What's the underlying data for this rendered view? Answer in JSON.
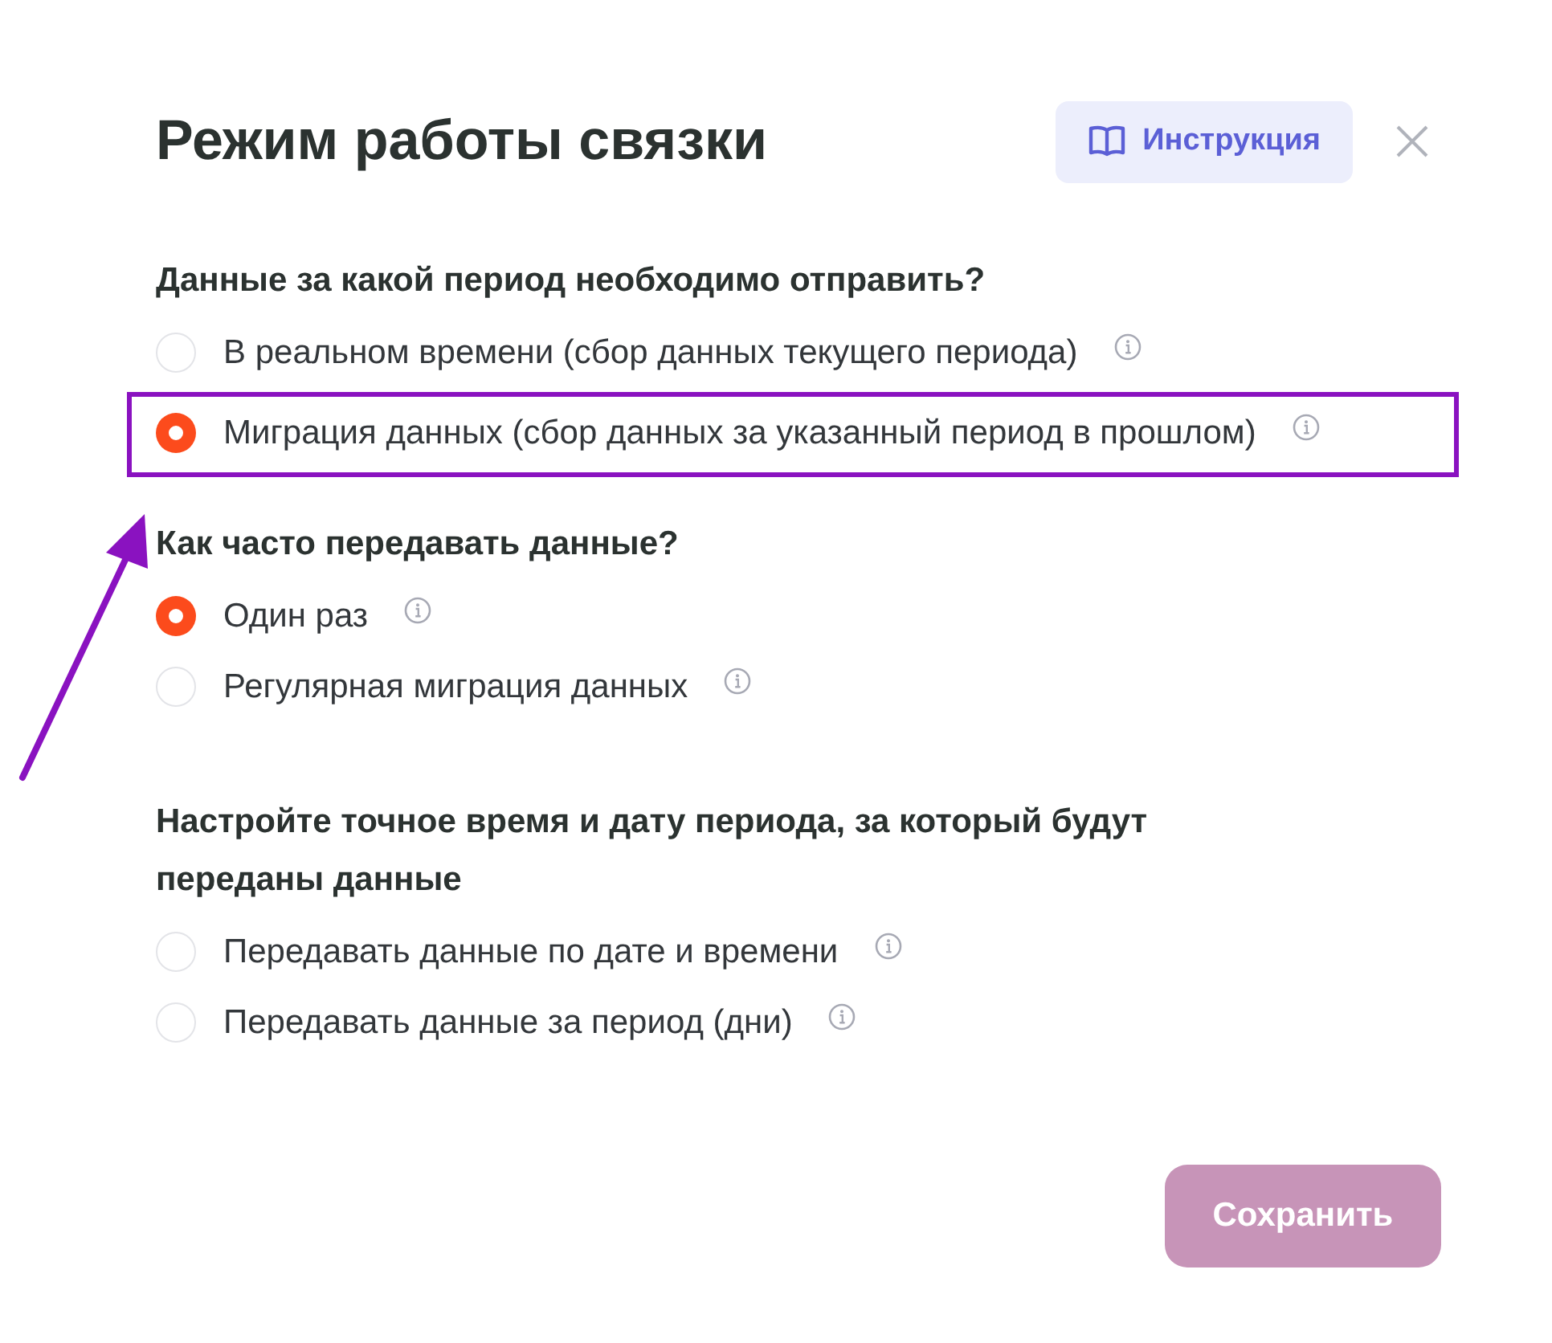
{
  "title": "Режим работы связки",
  "guide_button": {
    "label": "Инструкция"
  },
  "sections": [
    {
      "heading": "Данные за какой период необходимо отправить?",
      "options": [
        {
          "label": "В реальном времени (сбор данных текущего периода)",
          "selected": false,
          "highlighted": false
        },
        {
          "label": "Миграция данных (сбор данных за указанный период в прошлом)",
          "selected": true,
          "highlighted": true
        }
      ]
    },
    {
      "heading": "Как часто передавать данные?",
      "options": [
        {
          "label": "Один раз",
          "selected": true,
          "highlighted": false
        },
        {
          "label": "Регулярная миграция данных",
          "selected": false,
          "highlighted": false
        }
      ]
    },
    {
      "heading": "Настройте точное время и дату периода, за который будут переданы данные",
      "options": [
        {
          "label": "Передавать данные по дате и времени",
          "selected": false,
          "highlighted": false
        },
        {
          "label": "Передавать данные за период (дни)",
          "selected": false,
          "highlighted": false
        }
      ]
    }
  ],
  "save_button": {
    "label": "Сохранить"
  }
}
